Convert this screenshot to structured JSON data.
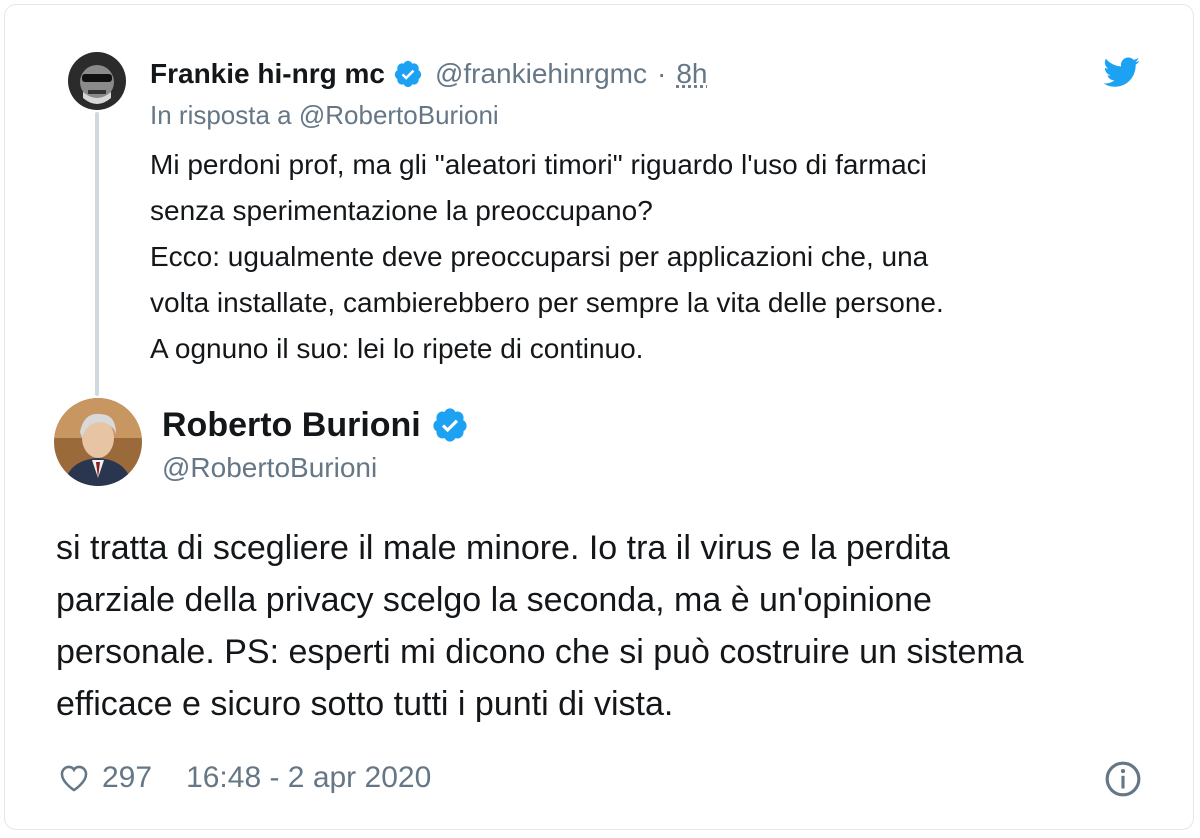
{
  "parent": {
    "author_name": "Frankie hi-nrg mc",
    "handle": "@frankiehinrgmc",
    "separator": "·",
    "time": "8h",
    "reply_to": "In risposta a @RobertoBurioni",
    "lines": [
      "Mi perdoni prof, ma gli \"aleatori timori\" riguardo l'uso di farmaci",
      "senza sperimentazione la preoccupano?",
      "Ecco: ugualmente deve preoccuparsi per applicazioni che, una",
      "volta installate, cambierebbero per sempre la vita delle persone.",
      "A ognuno il suo: lei lo ripete di continuo."
    ]
  },
  "main": {
    "author_name": "Roberto Burioni",
    "handle": "@RobertoBurioni",
    "lines": [
      "si tratta di scegliere il male minore. Io tra il virus e la perdita",
      "parziale della privacy scelgo la seconda, ma è un'opinione",
      "personale. PS: esperti mi dicono che si può costruire un sistema",
      "efficace e sicuro sotto tutti i punti di vista."
    ],
    "likes": "297",
    "timestamp": "16:48 - 2 apr 2020"
  },
  "colors": {
    "verified": "#1da1f2",
    "twitter_blue": "#1da1f2",
    "secondary_text": "#657786",
    "thread_line": "#cfd9de"
  },
  "icons": {
    "brand": "twitter-bird-icon",
    "verified": "verified-badge-icon",
    "like": "heart-icon",
    "info": "info-icon"
  }
}
